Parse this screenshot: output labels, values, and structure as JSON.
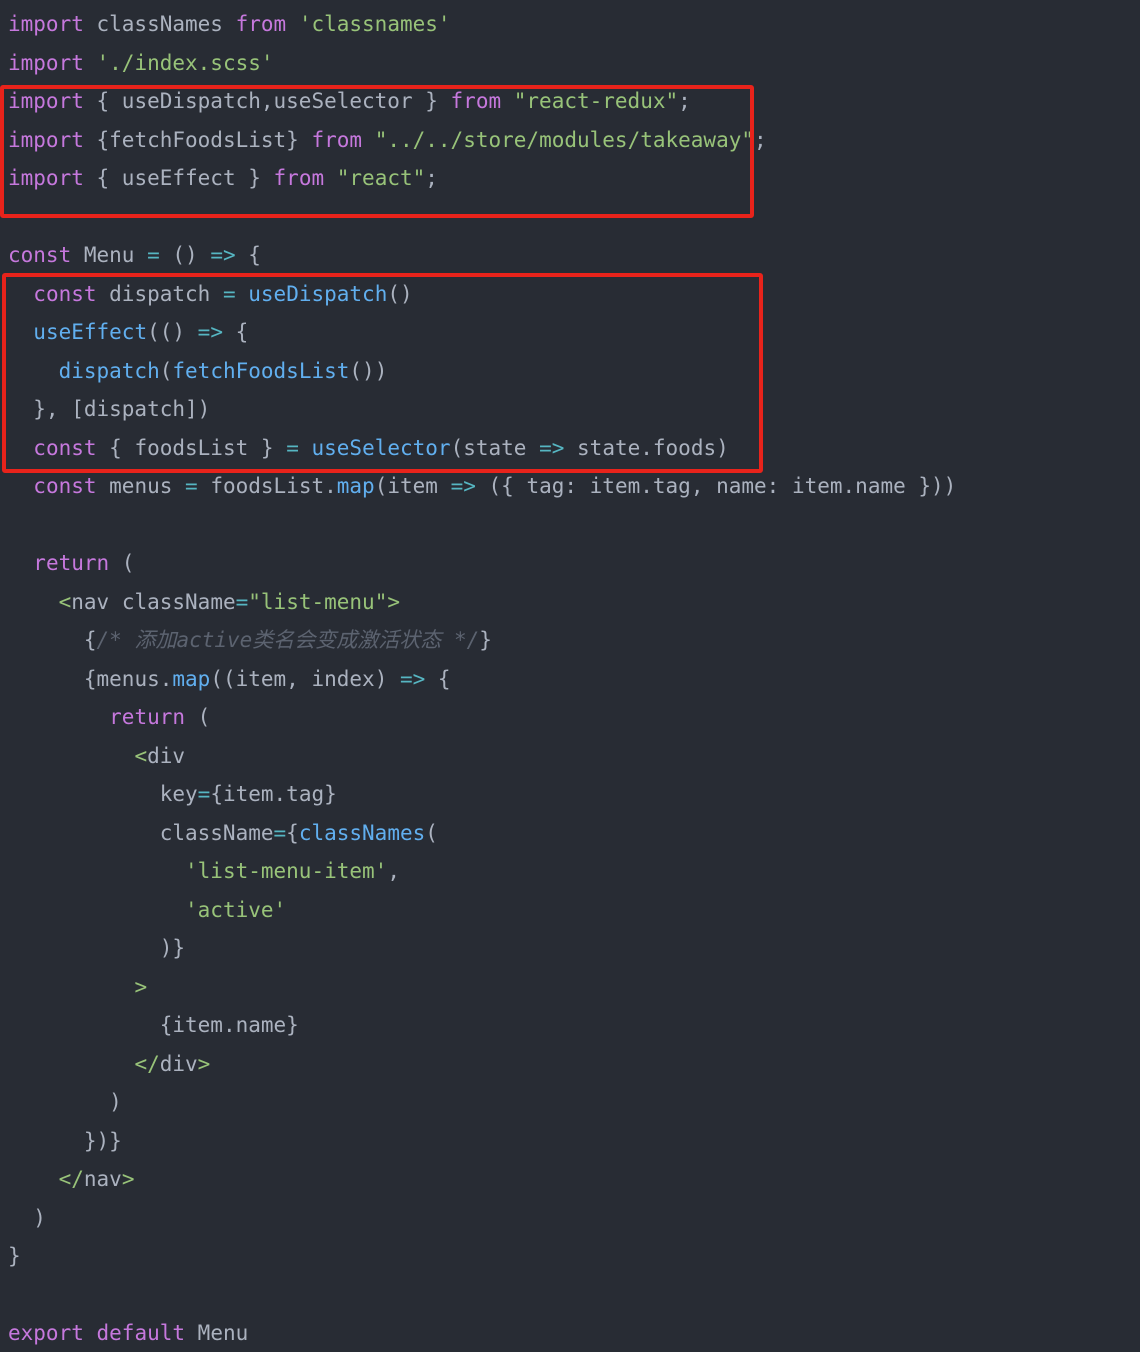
{
  "lines": [
    [
      [
        "keyword",
        "import"
      ],
      [
        "ident",
        " classNames "
      ],
      [
        "keyword",
        "from"
      ],
      [
        "ident",
        " "
      ],
      [
        "string",
        "'classnames'"
      ]
    ],
    [
      [
        "keyword",
        "import"
      ],
      [
        "ident",
        " "
      ],
      [
        "string",
        "'./index.scss'"
      ]
    ],
    [
      [
        "keyword",
        "import"
      ],
      [
        "punct",
        " { "
      ],
      [
        "ident",
        "useDispatch,useSelector"
      ],
      [
        "punct",
        " } "
      ],
      [
        "keyword",
        "from"
      ],
      [
        "ident",
        " "
      ],
      [
        "string",
        "\"react-redux\""
      ],
      [
        "punct",
        ";"
      ]
    ],
    [
      [
        "keyword",
        "import"
      ],
      [
        "punct",
        " {"
      ],
      [
        "ident",
        "fetchFoodsList"
      ],
      [
        "punct",
        "} "
      ],
      [
        "keyword",
        "from"
      ],
      [
        "ident",
        " "
      ],
      [
        "string",
        "\"../../store/modules/takeaway\""
      ],
      [
        "punct",
        ";"
      ]
    ],
    [
      [
        "keyword",
        "import"
      ],
      [
        "punct",
        " { "
      ],
      [
        "ident",
        "useEffect"
      ],
      [
        "punct",
        " } "
      ],
      [
        "keyword",
        "from"
      ],
      [
        "ident",
        " "
      ],
      [
        "string",
        "\"react\""
      ],
      [
        "punct",
        ";"
      ]
    ],
    [],
    [
      [
        "keyword",
        "const"
      ],
      [
        "ident",
        " Menu "
      ],
      [
        "operator",
        "="
      ],
      [
        "punct",
        " () "
      ],
      [
        "operator",
        "=>"
      ],
      [
        "punct",
        " {"
      ]
    ],
    [
      [
        "ident",
        "  "
      ],
      [
        "keyword",
        "const"
      ],
      [
        "ident",
        " dispatch "
      ],
      [
        "operator",
        "="
      ],
      [
        "ident",
        " "
      ],
      [
        "func",
        "useDispatch"
      ],
      [
        "punct",
        "()"
      ]
    ],
    [
      [
        "ident",
        "  "
      ],
      [
        "func",
        "useEffect"
      ],
      [
        "punct",
        "(() "
      ],
      [
        "operator",
        "=>"
      ],
      [
        "punct",
        " {"
      ]
    ],
    [
      [
        "ident",
        "    "
      ],
      [
        "func",
        "dispatch"
      ],
      [
        "punct",
        "("
      ],
      [
        "func",
        "fetchFoodsList"
      ],
      [
        "punct",
        "())"
      ]
    ],
    [
      [
        "punct",
        "  }, ["
      ],
      [
        "ident",
        "dispatch"
      ],
      [
        "punct",
        "])"
      ]
    ],
    [
      [
        "ident",
        "  "
      ],
      [
        "keyword",
        "const"
      ],
      [
        "punct",
        " { "
      ],
      [
        "ident",
        "foodsList"
      ],
      [
        "punct",
        " } "
      ],
      [
        "operator",
        "="
      ],
      [
        "ident",
        " "
      ],
      [
        "func",
        "useSelector"
      ],
      [
        "punct",
        "("
      ],
      [
        "ident",
        "state "
      ],
      [
        "operator",
        "=>"
      ],
      [
        "ident",
        " state.foods"
      ],
      [
        "punct",
        ")"
      ]
    ],
    [
      [
        "ident",
        "  "
      ],
      [
        "keyword",
        "const"
      ],
      [
        "ident",
        " menus "
      ],
      [
        "operator",
        "="
      ],
      [
        "ident",
        " foodsList."
      ],
      [
        "func",
        "map"
      ],
      [
        "punct",
        "("
      ],
      [
        "ident",
        "item "
      ],
      [
        "operator",
        "=>"
      ],
      [
        "punct",
        " ({ "
      ],
      [
        "ident",
        "tag: item.tag, name: item.name"
      ],
      [
        "punct",
        " }))"
      ]
    ],
    [],
    [
      [
        "ident",
        "  "
      ],
      [
        "keyword",
        "return"
      ],
      [
        "punct",
        " ("
      ]
    ],
    [
      [
        "ident",
        "    "
      ],
      [
        "tag",
        "<"
      ],
      [
        "ident",
        "nav "
      ],
      [
        "attr",
        "className"
      ],
      [
        "operator",
        "="
      ],
      [
        "string",
        "\"list-menu\""
      ],
      [
        "tag",
        ">"
      ]
    ],
    [
      [
        "ident",
        "      "
      ],
      [
        "punct",
        "{"
      ],
      [
        "comment",
        "/* 添加active类名会变成激活状态 */"
      ],
      [
        "punct",
        "}"
      ]
    ],
    [
      [
        "ident",
        "      "
      ],
      [
        "punct",
        "{"
      ],
      [
        "ident",
        "menus."
      ],
      [
        "func",
        "map"
      ],
      [
        "punct",
        "(("
      ],
      [
        "ident",
        "item, index"
      ],
      [
        "punct",
        ") "
      ],
      [
        "operator",
        "=>"
      ],
      [
        "punct",
        " {"
      ]
    ],
    [
      [
        "ident",
        "        "
      ],
      [
        "keyword",
        "return"
      ],
      [
        "punct",
        " ("
      ]
    ],
    [
      [
        "ident",
        "          "
      ],
      [
        "tag",
        "<"
      ],
      [
        "ident",
        "div"
      ]
    ],
    [
      [
        "ident",
        "            "
      ],
      [
        "attr",
        "key"
      ],
      [
        "operator",
        "="
      ],
      [
        "punct",
        "{"
      ],
      [
        "ident",
        "item.tag"
      ],
      [
        "punct",
        "}"
      ]
    ],
    [
      [
        "ident",
        "            "
      ],
      [
        "attr",
        "className"
      ],
      [
        "operator",
        "="
      ],
      [
        "punct",
        "{"
      ],
      [
        "func",
        "classNames"
      ],
      [
        "punct",
        "("
      ]
    ],
    [
      [
        "ident",
        "              "
      ],
      [
        "string",
        "'list-menu-item'"
      ],
      [
        "punct",
        ","
      ]
    ],
    [
      [
        "ident",
        "              "
      ],
      [
        "string",
        "'active'"
      ]
    ],
    [
      [
        "punct",
        "            )}"
      ]
    ],
    [
      [
        "ident",
        "          "
      ],
      [
        "tag",
        ">"
      ]
    ],
    [
      [
        "ident",
        "            "
      ],
      [
        "punct",
        "{"
      ],
      [
        "ident",
        "item.name"
      ],
      [
        "punct",
        "}"
      ]
    ],
    [
      [
        "ident",
        "          "
      ],
      [
        "tag",
        "</"
      ],
      [
        "ident",
        "div"
      ],
      [
        "tag",
        ">"
      ]
    ],
    [
      [
        "punct",
        "        )"
      ]
    ],
    [
      [
        "punct",
        "      })}"
      ]
    ],
    [
      [
        "ident",
        "    "
      ],
      [
        "tag",
        "</"
      ],
      [
        "ident",
        "nav"
      ],
      [
        "tag",
        ">"
      ]
    ],
    [
      [
        "punct",
        "  )"
      ]
    ],
    [
      [
        "punct",
        "}"
      ]
    ],
    [],
    [
      [
        "keyword",
        "export"
      ],
      [
        "ident",
        " "
      ],
      [
        "keyword",
        "default"
      ],
      [
        "ident",
        " Menu"
      ]
    ]
  ],
  "highlights": [
    {
      "name": "highlight-box-imports",
      "color": "#e8231b"
    },
    {
      "name": "highlight-box-hooks",
      "color": "#e8231b"
    }
  ]
}
